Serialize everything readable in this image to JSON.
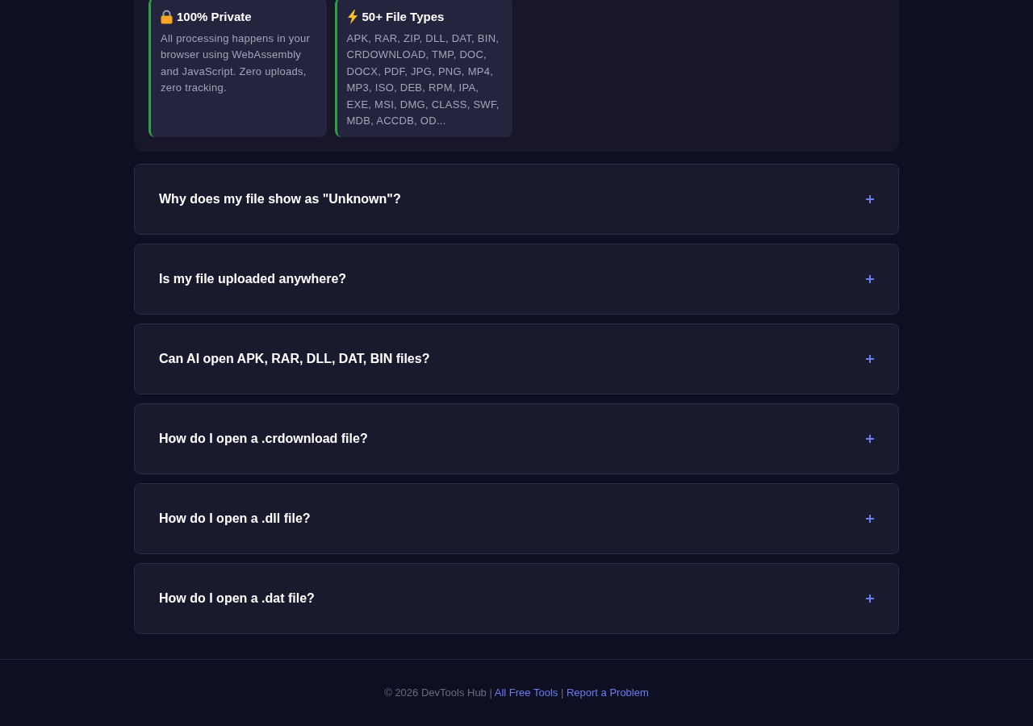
{
  "features": [
    {
      "kind": "lock",
      "title": "100% Private",
      "text": "All processing happens in your browser using WebAssembly and JavaScript. Zero uploads, zero tracking."
    },
    {
      "kind": "bolt",
      "title": "50+ File Types",
      "text": "APK, RAR, ZIP, DLL, DAT, BIN, CRDOWNLOAD, TMP, DOC, DOCX, PDF, JPG, PNG, MP4, MP3, ISO, DEB, RPM, IPA, EXE, MSI, DMG, CLASS, SWF, MDB, ACCDB, OD..."
    }
  ],
  "faq": [
    {
      "question": "Why does my file show as \"Unknown\"?",
      "expanded": false
    },
    {
      "question": "Is my file uploaded anywhere?",
      "expanded": false
    },
    {
      "question": "Can AI open APK, RAR, DLL, DAT, BIN files?",
      "expanded": false
    },
    {
      "question": "How do I open a .crdownload file?",
      "expanded": false
    },
    {
      "question": "How do I open a .dll file?",
      "expanded": false
    },
    {
      "question": "How do I open a .dat file?",
      "expanded": false
    }
  ],
  "footer": {
    "parts": [
      {
        "kind": "text",
        "text": "© 2026 DevTools Hub |"
      },
      {
        "kind": "link",
        "text": "All Free Tools"
      },
      {
        "kind": "text",
        "text": "|"
      },
      {
        "kind": "link",
        "text": "Report a Problem"
      }
    ]
  }
}
